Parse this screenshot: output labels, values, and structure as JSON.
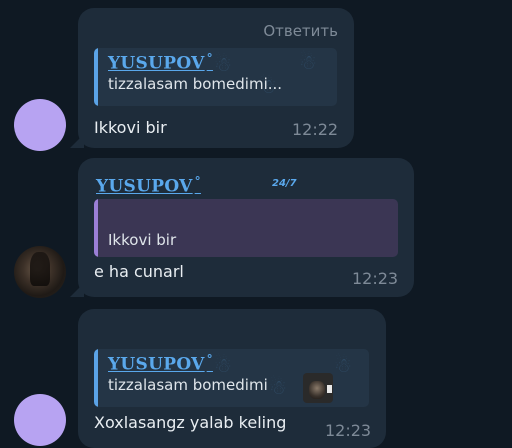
{
  "messages": [
    {
      "reply_label": "Ответить",
      "quote_name": "YUSUPOV",
      "quote_mark": "°",
      "quote_text": "tizzalasam bomedimi...",
      "text": "Ikkovi bir",
      "time": "12:22"
    },
    {
      "sender": "YUSUPOV",
      "sender_mark": "°",
      "badge": "24/7",
      "quote_text": "Ikkovi bir",
      "text": "e ha cunarl",
      "time": "12:23"
    },
    {
      "quote_name": "YUSUPOV",
      "quote_mark": "°",
      "quote_text": "tizzalasam bomedimi",
      "text": "Xoxlasangz yalab keling",
      "time": "12:23"
    }
  ],
  "icons": {
    "pattern": "ghost-sticker-pattern",
    "avatar_1": "purple-avatar",
    "avatar_2": "photo-avatar",
    "avatar_3": "purple-avatar"
  },
  "colors": {
    "background": "#0f1923",
    "bubble": "#1e2c3a",
    "accent": "#5aa8ec",
    "quote_bar_purple": "#9b7fd6"
  }
}
